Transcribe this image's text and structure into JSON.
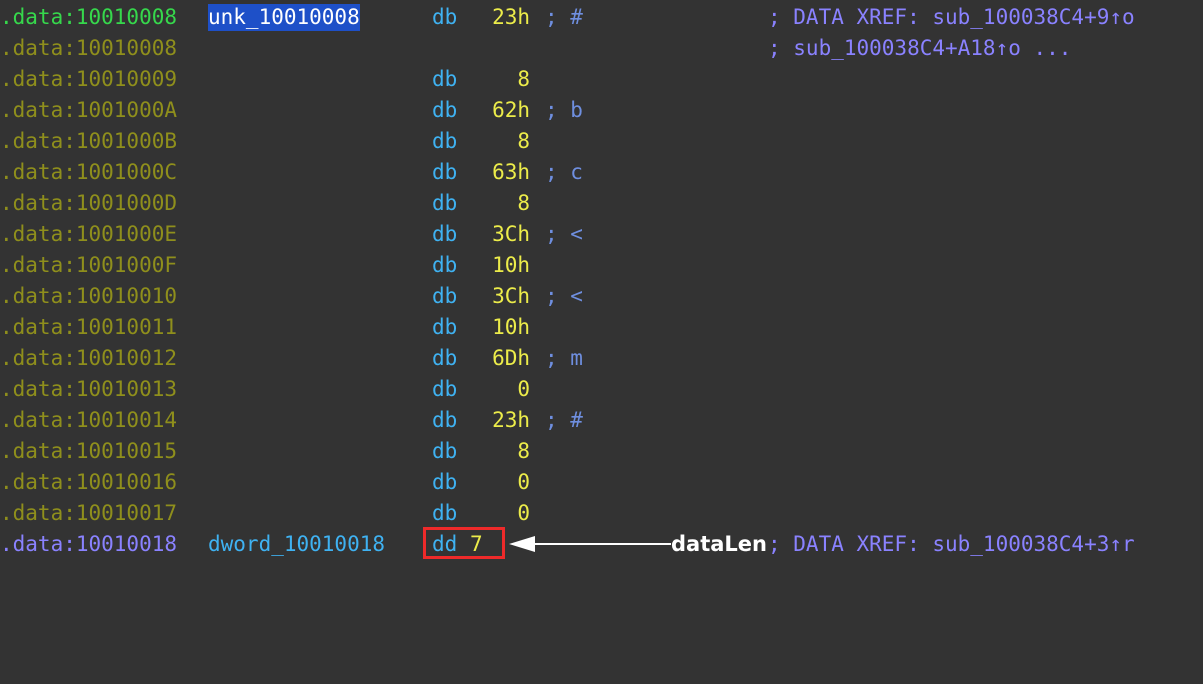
{
  "rows": [
    {
      "address": ".data:10010008",
      "label": "unk_10010008",
      "mnemonic": "db",
      "operand": "23h",
      "comment": "; #",
      "xref": "; DATA XREF: sub_100038C4+9↑o"
    },
    {
      "address": ".data:10010008",
      "label": "",
      "mnemonic": "",
      "operand": "",
      "comment": "",
      "xref": "; sub_100038C4+A18↑o ..."
    },
    {
      "address": ".data:10010009",
      "label": "",
      "mnemonic": "db",
      "operand": "8",
      "comment": "",
      "xref": ""
    },
    {
      "address": ".data:1001000A",
      "label": "",
      "mnemonic": "db",
      "operand": "62h",
      "comment": "; b",
      "xref": ""
    },
    {
      "address": ".data:1001000B",
      "label": "",
      "mnemonic": "db",
      "operand": "8",
      "comment": "",
      "xref": ""
    },
    {
      "address": ".data:1001000C",
      "label": "",
      "mnemonic": "db",
      "operand": "63h",
      "comment": "; c",
      "xref": ""
    },
    {
      "address": ".data:1001000D",
      "label": "",
      "mnemonic": "db",
      "operand": "8",
      "comment": "",
      "xref": ""
    },
    {
      "address": ".data:1001000E",
      "label": "",
      "mnemonic": "db",
      "operand": "3Ch",
      "comment": "; <",
      "xref": ""
    },
    {
      "address": ".data:1001000F",
      "label": "",
      "mnemonic": "db",
      "operand": "10h",
      "comment": "",
      "xref": ""
    },
    {
      "address": ".data:10010010",
      "label": "",
      "mnemonic": "db",
      "operand": "3Ch",
      "comment": "; <",
      "xref": ""
    },
    {
      "address": ".data:10010011",
      "label": "",
      "mnemonic": "db",
      "operand": "10h",
      "comment": "",
      "xref": ""
    },
    {
      "address": ".data:10010012",
      "label": "",
      "mnemonic": "db",
      "operand": "6Dh",
      "comment": "; m",
      "xref": ""
    },
    {
      "address": ".data:10010013",
      "label": "",
      "mnemonic": "db",
      "operand": "0",
      "comment": "",
      "xref": ""
    },
    {
      "address": ".data:10010014",
      "label": "",
      "mnemonic": "db",
      "operand": "23h",
      "comment": "; #",
      "xref": ""
    },
    {
      "address": ".data:10010015",
      "label": "",
      "mnemonic": "db",
      "operand": "8",
      "comment": "",
      "xref": ""
    },
    {
      "address": ".data:10010016",
      "label": "",
      "mnemonic": "db",
      "operand": "0",
      "comment": "",
      "xref": ""
    },
    {
      "address": ".data:10010017",
      "label": "",
      "mnemonic": "db",
      "operand": "0",
      "comment": "",
      "xref": ""
    }
  ],
  "last_row": {
    "address": ".data:10010018",
    "label": "dword_10010018",
    "mnemonic": "dd",
    "operand": "7",
    "xref": "; DATA XREF: sub_100038C4+3↑r"
  },
  "annotation": {
    "text": "dataLen",
    "arrow": "left-arrow",
    "highlight_color": "#ee2a2a",
    "arrow_color": "#ffffff"
  },
  "colors": {
    "background": "#333333",
    "address": "#8f8f1c",
    "address_current": "#36d84c",
    "address_named": "#8a82ff",
    "mnemonic": "#3fb2f2",
    "operand": "#ecec4a",
    "selection": "#1e50c8"
  }
}
